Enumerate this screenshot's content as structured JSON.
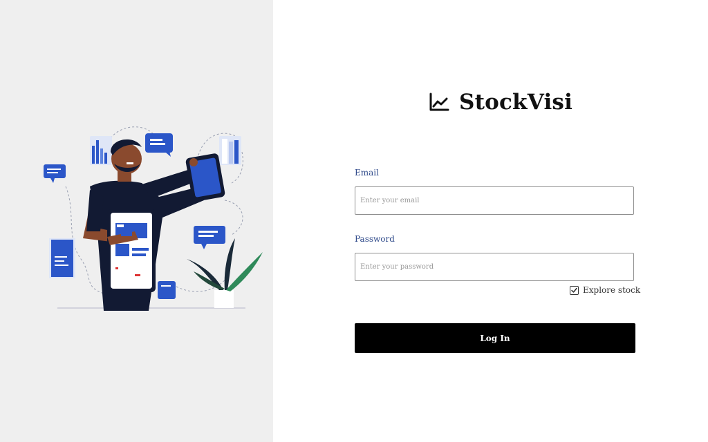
{
  "brand": {
    "name": "StockVisi",
    "icon": "line-chart-icon"
  },
  "form": {
    "email_label": "Email",
    "email_placeholder": "Enter your email",
    "email_value": "",
    "password_label": "Password",
    "password_placeholder": "Enter your password",
    "password_value": "",
    "explore_label": "Explore stock",
    "explore_checked": true,
    "login_label": "Log In"
  },
  "illustration": {
    "subject": "person-with-phones-illustration"
  },
  "colors": {
    "left_panel_bg": "#efefef",
    "label_color": "#2f4a8a",
    "button_bg": "#000000",
    "button_text": "#ffffff",
    "accent_blue": "#2b56c8"
  }
}
